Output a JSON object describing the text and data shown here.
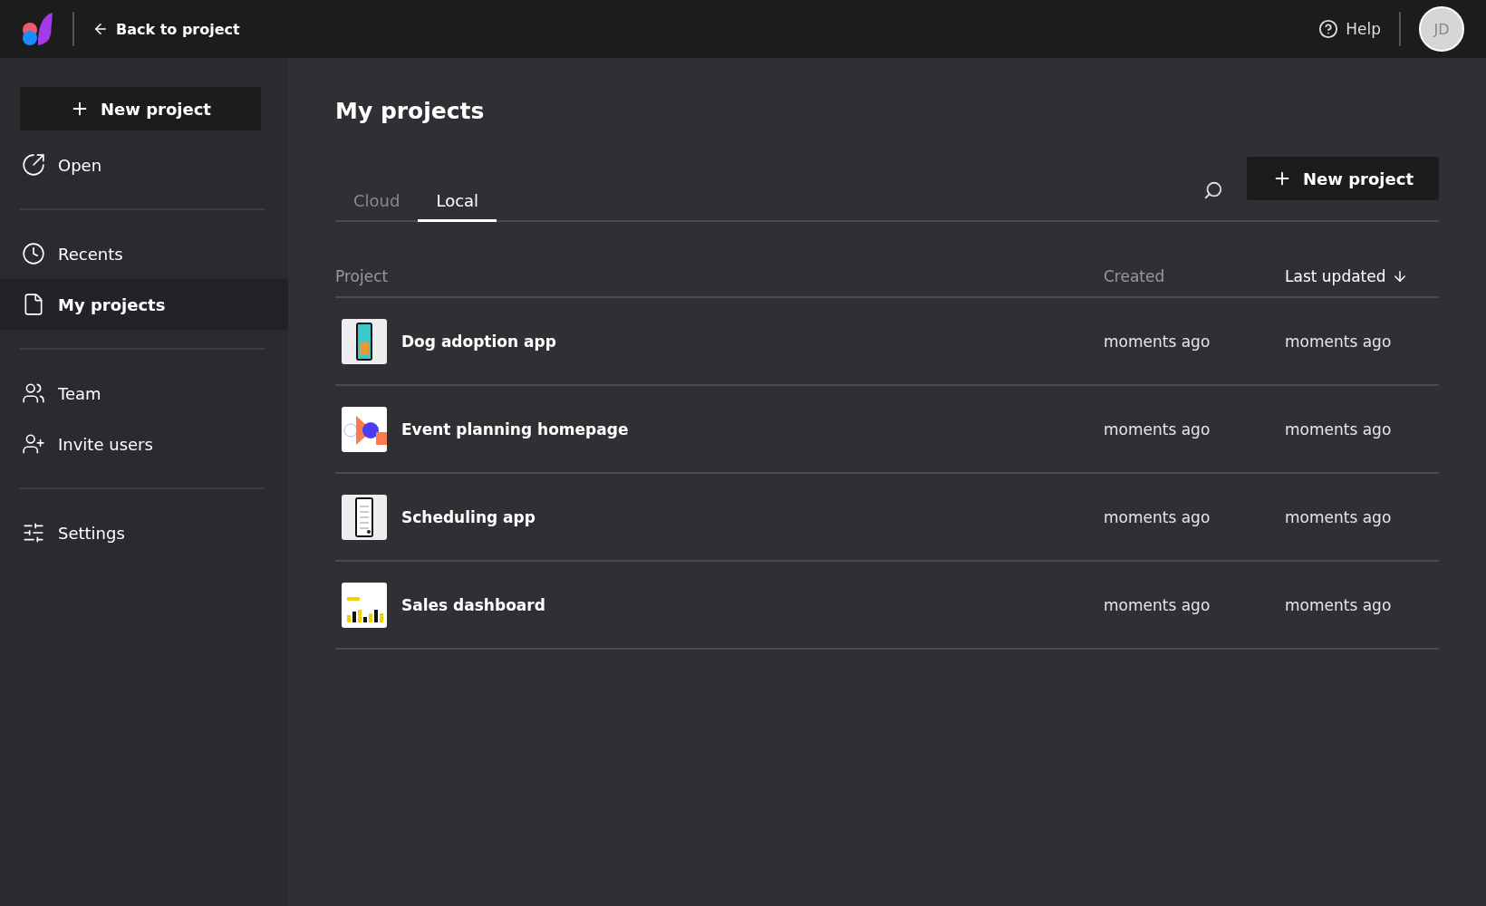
{
  "top_bar": {
    "back_link": "Back to project",
    "help": "Help",
    "avatar": "JD"
  },
  "sidebar": {
    "new_button": "New project",
    "groups": [
      [
        {
          "label": "Open",
          "selected": false
        }
      ],
      [
        {
          "label": "Recents",
          "selected": false
        },
        {
          "label": "My projects",
          "selected": true
        }
      ],
      [
        {
          "label": "Team",
          "selected": false
        },
        {
          "label": "Invite users",
          "selected": false
        }
      ],
      [
        {
          "label": "Settings",
          "selected": false
        }
      ]
    ]
  },
  "main": {
    "title": "My projects",
    "new_button": "New project",
    "tabs": [
      {
        "label": "Cloud",
        "selected": false
      },
      {
        "label": "Local",
        "selected": true
      }
    ],
    "table": {
      "columns": [
        {
          "label": "Project",
          "sorted": false
        },
        {
          "label": "Created",
          "sorted": false
        },
        {
          "label": "Last updated",
          "sorted": true
        }
      ],
      "rows": [
        {
          "name": "Dog adoption app",
          "created": "moments ago",
          "updated": "moments ago"
        },
        {
          "name": "Event planning homepage",
          "created": "moments ago",
          "updated": "moments ago"
        },
        {
          "name": "Scheduling app",
          "created": "moments ago",
          "updated": "moments ago"
        },
        {
          "name": "Sales dashboard",
          "created": "moments ago",
          "updated": "moments ago"
        }
      ]
    }
  }
}
